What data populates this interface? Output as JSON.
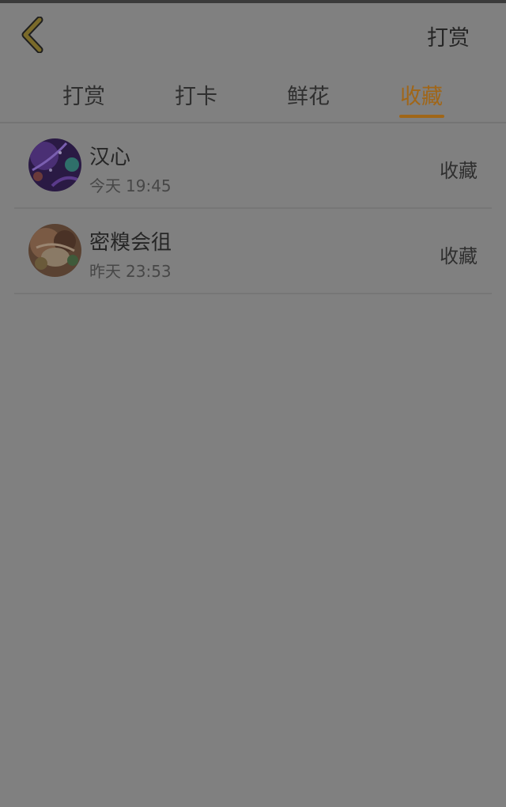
{
  "header": {
    "top_right_label": "打赏"
  },
  "tabs": [
    {
      "label": "打赏",
      "active": false
    },
    {
      "label": "打卡",
      "active": false
    },
    {
      "label": "鲜花",
      "active": false
    },
    {
      "label": "收藏",
      "active": true
    }
  ],
  "list": {
    "items": [
      {
        "name": "汉心",
        "date": "今天",
        "time": "19:45",
        "action": "收藏"
      },
      {
        "name": "密糗会徂",
        "date": "昨天",
        "time": "23:53",
        "action": "收藏"
      }
    ]
  },
  "colors": {
    "accent": "#a06618",
    "background": "#808080",
    "back_icon": "#7a6a2a"
  },
  "icons": {
    "back": "chevron-left-icon"
  }
}
